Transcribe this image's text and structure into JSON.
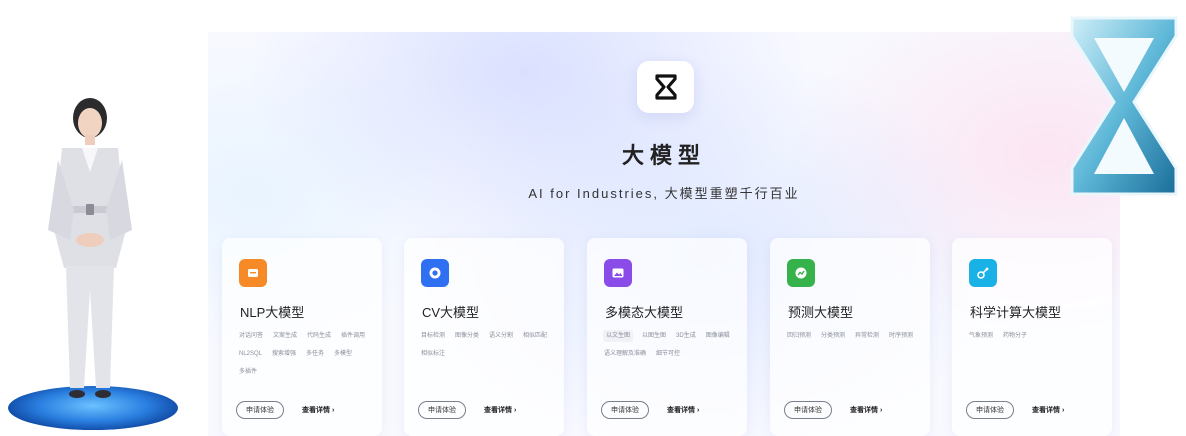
{
  "hero": {
    "title": "大模型",
    "subtitle": "AI for Industries, 大模型重塑千行百业"
  },
  "colors": {
    "accent": "#2a7fe0",
    "nlp": "#f58a27",
    "cv": "#2f6ff2",
    "multimodal": "#8a4ce8",
    "forecast": "#36b24a",
    "science": "#19b1e6"
  },
  "cards": [
    {
      "title": "NLP大模型",
      "icon": "document-icon",
      "tags": [
        "对话问答",
        "文案生成",
        "代码生成",
        "插件调用",
        "NL2SQL",
        "搜索增强",
        "多任务",
        "多模型",
        "多插件"
      ],
      "apply": "申请体验",
      "detail": "查看详情 ›"
    },
    {
      "title": "CV大模型",
      "icon": "eye-icon",
      "tags": [
        "目标检测",
        "图像分类",
        "语义分割",
        "相似匹配",
        "相似标注"
      ],
      "apply": "申请体验",
      "detail": "查看详情 ›"
    },
    {
      "title": "多模态大模型",
      "icon": "image-icon",
      "tags": [
        "以文生图",
        "以图生图",
        "3D生成",
        "图像编辑",
        "语义理解及准确",
        "细节可控"
      ],
      "apply": "申请体验",
      "detail": "查看详情 ›"
    },
    {
      "title": "预测大模型",
      "icon": "chart-bubble-icon",
      "tags": [
        "回归预测",
        "分类预测",
        "异常检测",
        "时序预测"
      ],
      "apply": "申请体验",
      "detail": "查看详情 ›"
    },
    {
      "title": "科学计算大模型",
      "icon": "molecule-icon",
      "tags": [
        "气象预测",
        "药物分子"
      ],
      "apply": "申请体验",
      "detail": "查看详情 ›"
    }
  ]
}
